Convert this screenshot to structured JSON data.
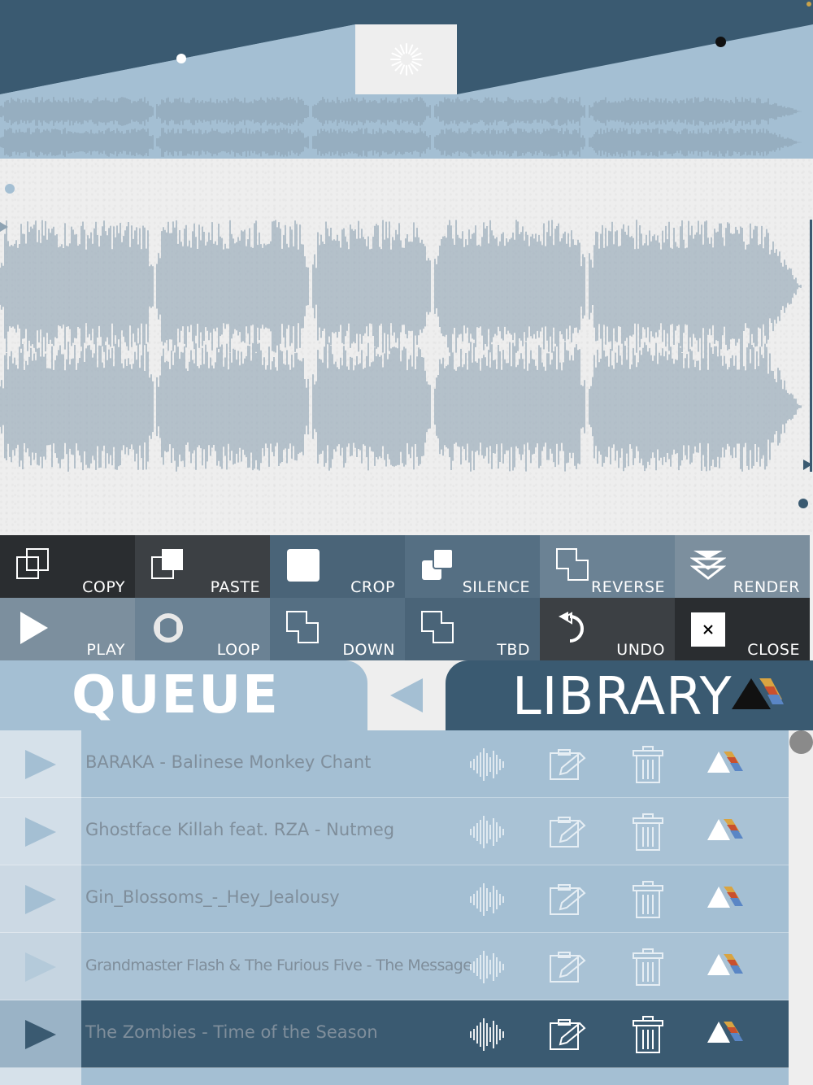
{
  "colors": {
    "dark_slate": "#3a5a71",
    "light_blue": "#a4bfd3",
    "wave_gray": "#8ea3b3",
    "paper": "#eeeeee",
    "toolbar_dark": "#2a2d30",
    "toolbar_mid": "#3c4044",
    "toolbar_blue": "#4a6478",
    "toolbar_light": "#7c8f9e"
  },
  "toolbar": {
    "row1": [
      {
        "label": "COPY",
        "icon": "copy-icon"
      },
      {
        "label": "PASTE",
        "icon": "paste-icon"
      },
      {
        "label": "CROP",
        "icon": "crop-icon"
      },
      {
        "label": "SILENCE",
        "icon": "silence-icon"
      },
      {
        "label": "REVERSE",
        "icon": "reverse-icon"
      },
      {
        "label": "RENDER",
        "icon": "render-icon"
      }
    ],
    "row2": [
      {
        "label": "PLAY",
        "icon": "play-icon"
      },
      {
        "label": "LOOP",
        "icon": "loop-icon"
      },
      {
        "label": "DOWN",
        "icon": "down-icon"
      },
      {
        "label": "TBD",
        "icon": "tbd-icon"
      },
      {
        "label": "UNDO",
        "icon": "undo-icon"
      },
      {
        "label": "CLOSE",
        "icon": "close-icon"
      }
    ]
  },
  "tabs": {
    "queue": "QUEUE",
    "library": "LIBRARY"
  },
  "library": {
    "tracks": [
      {
        "title": "BARAKA - Balinese Monkey Chant",
        "selected": false
      },
      {
        "title": "Ghostface Killah feat. RZA - Nutmeg",
        "selected": false
      },
      {
        "title": "Gin_Blossoms_-_Hey_Jealousy",
        "selected": false
      },
      {
        "title": "Grandmaster Flash & The Furious Five - The Message",
        "selected": false
      },
      {
        "title": "The Zombies - Time of the Season",
        "selected": true
      }
    ]
  }
}
